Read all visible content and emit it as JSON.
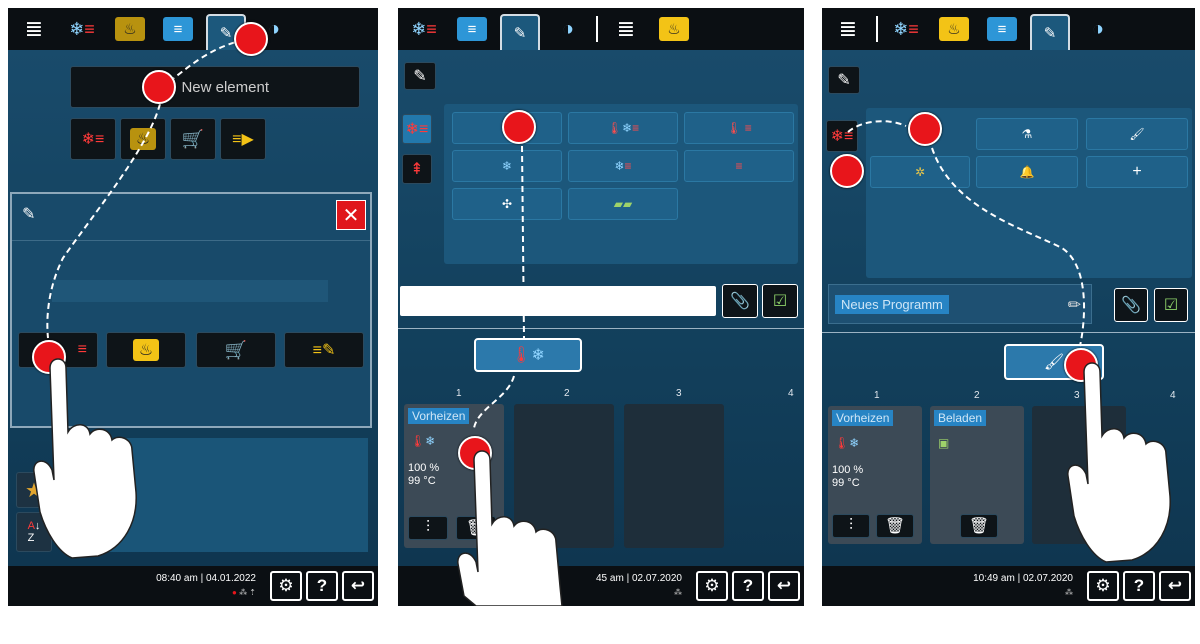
{
  "panel1": {
    "clock": "08:40 am | 04.01.2022",
    "new_element_label": "New element"
  },
  "panel2": {
    "clock": "45 am | 02.07.2020",
    "step1_name": "Vorheizen",
    "step1_values": [
      "100 %",
      "99 °C"
    ],
    "slot_numbers": [
      "1",
      "2",
      "3",
      "4"
    ]
  },
  "panel3": {
    "clock": "10:49 am | 02.07.2020",
    "program_name": "Neues Programm",
    "step1_name": "Vorheizen",
    "step1_values": [
      "100 %",
      "99 °C"
    ],
    "step2_name": "Beladen",
    "slot_numbers": [
      "1",
      "2",
      "3",
      "4"
    ]
  },
  "bottom_icons": [
    "settings-icon",
    "help-icon",
    "back-icon"
  ],
  "colors": {
    "accent_red": "#e8151b",
    "yellow": "#f3c316",
    "blue": "#2d96d7",
    "panel": "#123a54"
  }
}
